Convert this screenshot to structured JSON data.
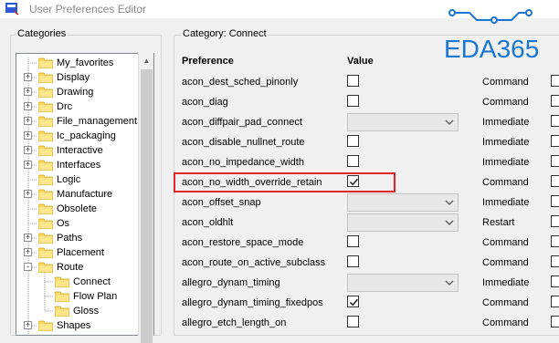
{
  "window": {
    "title": "User Preferences Editor"
  },
  "watermark": {
    "text": "EDA365",
    "color": "#1976d2"
  },
  "left_panel": {
    "group_label": "Categories",
    "tree": [
      {
        "label": "My_favorites",
        "level": 0,
        "expander": ""
      },
      {
        "label": "Display",
        "level": 0,
        "expander": "+"
      },
      {
        "label": "Drawing",
        "level": 0,
        "expander": "+"
      },
      {
        "label": "Drc",
        "level": 0,
        "expander": "+"
      },
      {
        "label": "File_management",
        "level": 0,
        "expander": "+"
      },
      {
        "label": "Ic_packaging",
        "level": 0,
        "expander": "+"
      },
      {
        "label": "Interactive",
        "level": 0,
        "expander": "+"
      },
      {
        "label": "Interfaces",
        "level": 0,
        "expander": "+"
      },
      {
        "label": "Logic",
        "level": 0,
        "expander": ""
      },
      {
        "label": "Manufacture",
        "level": 0,
        "expander": "+"
      },
      {
        "label": "Obsolete",
        "level": 0,
        "expander": ""
      },
      {
        "label": "Os",
        "level": 0,
        "expander": ""
      },
      {
        "label": "Paths",
        "level": 0,
        "expander": "+"
      },
      {
        "label": "Placement",
        "level": 0,
        "expander": "+"
      },
      {
        "label": "Route",
        "level": 0,
        "expander": "-"
      },
      {
        "label": "Connect",
        "level": 1,
        "expander": ""
      },
      {
        "label": "Flow Plan",
        "level": 1,
        "expander": ""
      },
      {
        "label": "Gloss",
        "level": 1,
        "expander": ""
      },
      {
        "label": "Shapes",
        "level": 0,
        "expander": "+"
      }
    ]
  },
  "right_panel": {
    "category_label": "Category:  Connect",
    "columns": {
      "preference": "Preference",
      "value": "Value"
    },
    "rows": [
      {
        "name": "acon_dest_sched_pinonly",
        "control": "checkbox",
        "checked": false,
        "type": "Command"
      },
      {
        "name": "acon_diag",
        "control": "checkbox",
        "checked": false,
        "type": "Command"
      },
      {
        "name": "acon_diffpair_pad_connect",
        "control": "combo",
        "checked": false,
        "type": "Immediate"
      },
      {
        "name": "acon_disable_nullnet_route",
        "control": "checkbox",
        "checked": false,
        "type": "Immediate"
      },
      {
        "name": "acon_no_impedance_width",
        "control": "checkbox",
        "checked": false,
        "type": "Immediate"
      },
      {
        "name": "acon_no_width_override_retain",
        "control": "checkbox",
        "checked": true,
        "type": "Command"
      },
      {
        "name": "acon_offset_snap",
        "control": "combo",
        "checked": false,
        "type": "Immediate"
      },
      {
        "name": "acon_oldhlt",
        "control": "combo",
        "checked": false,
        "type": "Restart"
      },
      {
        "name": "acon_restore_space_mode",
        "control": "checkbox",
        "checked": false,
        "type": "Command"
      },
      {
        "name": "acon_route_on_active_subclass",
        "control": "checkbox",
        "checked": false,
        "type": "Command"
      },
      {
        "name": "allegro_dynam_timing",
        "control": "combo",
        "checked": false,
        "type": "Immediate"
      },
      {
        "name": "allegro_dynam_timing_fixedpos",
        "control": "checkbox",
        "checked": true,
        "type": "Command"
      },
      {
        "name": "allegro_etch_length_on",
        "control": "checkbox",
        "checked": false,
        "type": "Command"
      }
    ],
    "highlight_color": "#e0262a"
  }
}
